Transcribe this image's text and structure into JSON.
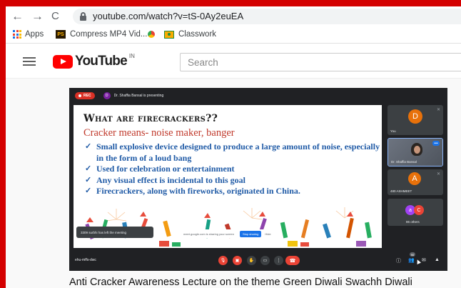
{
  "browser": {
    "nav_back": "←",
    "nav_forward": "→",
    "nav_reload": "C",
    "url": "youtube.com/watch?v=tS-0Ay2euEA",
    "bookmarks": [
      "Apps",
      "Compress MP4 Vid...",
      "Classwork"
    ],
    "bookmark_icon_label": "PS"
  },
  "youtube": {
    "logo_text": "YouTube",
    "region": "IN",
    "search_placeholder": "Search"
  },
  "meet": {
    "rec_label": "REC",
    "presenter_initial": "D",
    "presenting_text": "Dr. Shaffia Bansal is presenting",
    "toast": "3309 surbhi has left the meeting",
    "share_text": "meet.google.com is sharing your screen",
    "stop_sharing": "Stop sharing",
    "hide": "Hide",
    "meeting_code": "ehu-mffs-dwc",
    "tiles": [
      {
        "initial": "D",
        "name": "You",
        "color": "#e8710a"
      },
      {
        "initial": "",
        "name": "Dr. Shaffia Bansal",
        "color": ""
      },
      {
        "initial": "A",
        "name": "480 ASHMEET",
        "color": "#e8710a"
      },
      {
        "initials": [
          "a",
          "C"
        ],
        "name": "86 others",
        "colors": [
          "#a142f4",
          "#ea4335"
        ]
      }
    ],
    "people_count": "90",
    "controls": {
      "mic": "mic-off-icon",
      "camera": "camera-off-icon",
      "hand": "raise-hand-icon",
      "present": "present-icon",
      "more": "more-icon",
      "end": "end-call-icon"
    }
  },
  "slide": {
    "title": "What are firecrackers??",
    "subtitle": "Cracker means- noise maker, banger",
    "bullets": [
      [
        "Small explosive device designed to produce a large amount of noise, especially",
        "in the form of a loud bang"
      ],
      [
        "Used for celebration or entertainment"
      ],
      [
        "Any visual effect is incidental to this goal"
      ],
      [
        "Firecrackers, along with fireworks, originated in China."
      ]
    ]
  },
  "video": {
    "title": "Anti Cracker Awareness Lecture on the theme Green Diwali Swachh Diwali"
  }
}
